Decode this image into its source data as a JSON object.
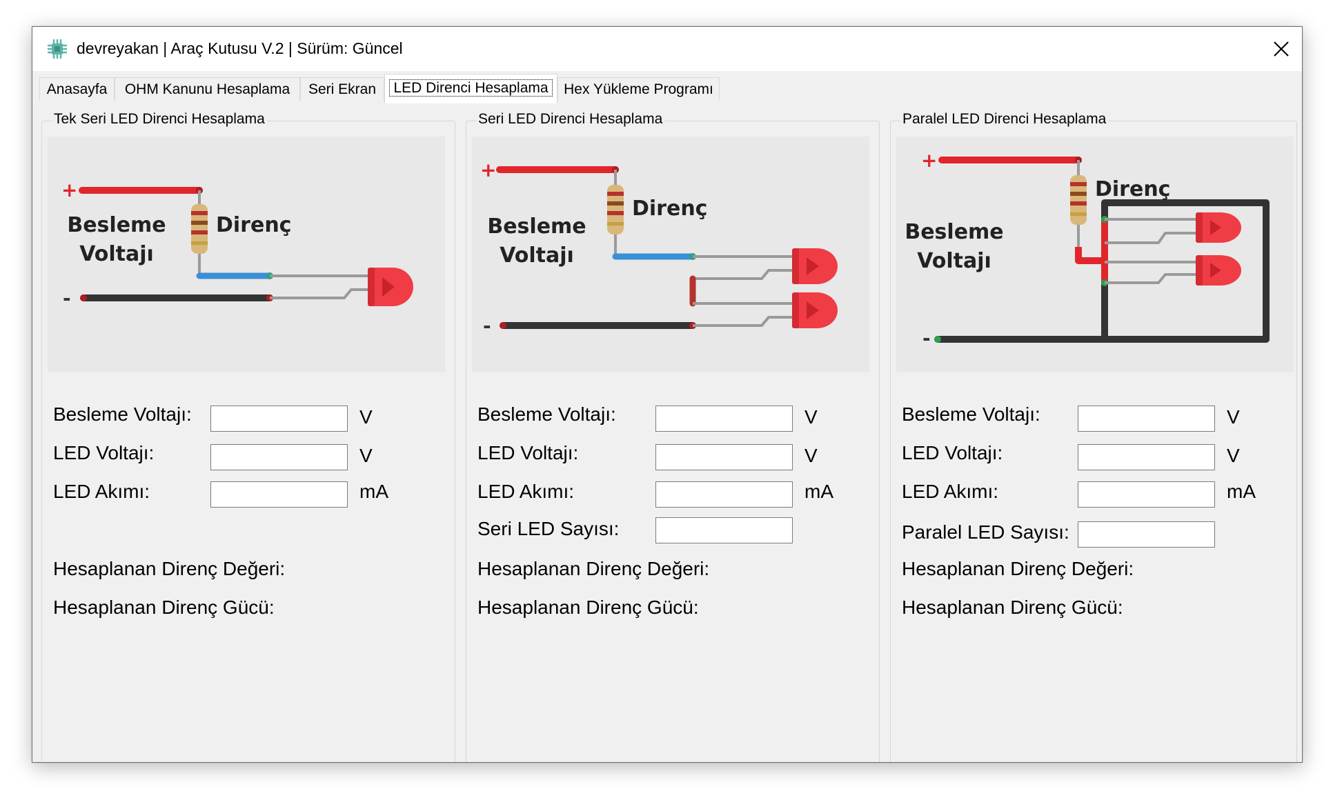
{
  "window": {
    "title": "devreyakan | Araç Kutusu V.2 | Sürüm: Güncel",
    "icon": "chip-icon",
    "close_glyph": "✕"
  },
  "tabs": [
    {
      "label": "Anasayfa",
      "active": false
    },
    {
      "label": "OHM Kanunu Hesaplama",
      "active": false
    },
    {
      "label": "Seri Ekran",
      "active": false
    },
    {
      "label": "LED Direnci Hesaplama",
      "active": true
    },
    {
      "label": "Hex Yükleme Programı",
      "active": false
    }
  ],
  "diagram_text": {
    "plus": "+",
    "minus": "-",
    "supply_line1": "Besleme",
    "supply_line2": "Voltajı",
    "resistor": "Direnç"
  },
  "groups": [
    {
      "title": "Tek Seri LED Direnci Hesaplama",
      "fields": [
        {
          "label": "Besleme Voltajı:",
          "value": "",
          "unit": "V"
        },
        {
          "label": "LED Voltajı:",
          "value": "",
          "unit": "V"
        },
        {
          "label": "LED Akımı:",
          "value": "",
          "unit": "mA"
        }
      ],
      "result_resistance": "Hesaplanan Direnç Değeri:",
      "result_power": "Hesaplanan Direnç Gücü:"
    },
    {
      "title": "Seri LED Direnci Hesaplama",
      "fields": [
        {
          "label": "Besleme Voltajı:",
          "value": "",
          "unit": "V"
        },
        {
          "label": "LED Voltajı:",
          "value": "",
          "unit": "V"
        },
        {
          "label": "LED Akımı:",
          "value": "",
          "unit": "mA"
        },
        {
          "label": "Seri LED Sayısı:",
          "value": ""
        }
      ],
      "result_resistance": "Hesaplanan Direnç Değeri:",
      "result_power": "Hesaplanan Direnç Gücü:"
    },
    {
      "title": "Paralel LED Direnci Hesaplama",
      "fields": [
        {
          "label": "Besleme Voltajı:",
          "value": "",
          "unit": "V"
        },
        {
          "label": "LED Voltajı:",
          "value": "",
          "unit": "V"
        },
        {
          "label": "LED Akımı:",
          "value": "",
          "unit": "mA"
        },
        {
          "label": "Paralel LED Sayısı:",
          "value": ""
        }
      ],
      "result_resistance": "Hesaplanan Direnç Değeri:",
      "result_power": "Hesaplanan Direnç Gücü:"
    }
  ],
  "colors": {
    "wire_positive": "#e0262b",
    "wire_negative": "#333333",
    "wire_resistor_out": "#3a8fd6",
    "led_red": "#f03c45"
  }
}
